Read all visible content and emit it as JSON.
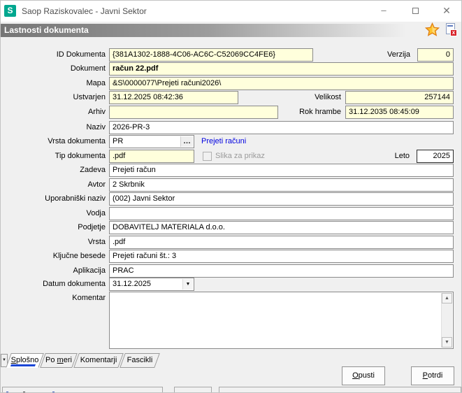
{
  "window": {
    "title": "Saop Raziskovalec - Javni Sektor",
    "logo_letter": "S"
  },
  "header": {
    "title": "Lastnosti dokumenta"
  },
  "icons": {
    "minimize": "–",
    "close": "✕",
    "star": "★",
    "doc_delete_x": "x",
    "ellipsis": "…",
    "dropdown": "▼",
    "tab_scroll": "▼",
    "scroll_up": "▲",
    "scroll_down": "▼"
  },
  "colors": {
    "logo-teal": "#00a78f",
    "field-yellow": "#ffffdc",
    "border-field": "#8a8a8a",
    "link-blue": "#0000e0",
    "tab-accent": "#1b46d6"
  },
  "fields": {
    "id": {
      "label": "ID Dokumenta",
      "value": "{381A1302-1888-4C06-AC6C-C52069CC4FE6}"
    },
    "verzija": {
      "label": "Verzija",
      "value": "0"
    },
    "dokument": {
      "label": "Dokument",
      "value": "račun 22.pdf"
    },
    "mapa": {
      "label": "Mapa",
      "value": "&S\\0000077\\Prejeti računi2026\\"
    },
    "ustvarjen": {
      "label": "Ustvarjen",
      "value": "31.12.2025 08:42:36"
    },
    "velikost": {
      "label": "Velikost",
      "value": "257144"
    },
    "arhiv": {
      "label": "Arhiv",
      "value": ""
    },
    "rok_hrambe": {
      "label": "Rok hrambe",
      "value": "31.12.2035 08:45:09"
    },
    "naziv": {
      "label": "Naziv",
      "value": "2026-PR-3"
    },
    "vrsta_dokumenta": {
      "label": "Vrsta dokumenta",
      "value": "PR",
      "link": "Prejeti računi"
    },
    "tip_dokumenta": {
      "label": "Tip dokumenta",
      "value": ".pdf",
      "checkbox_label": "Slika za prikaz"
    },
    "leto": {
      "label": "Leto",
      "value": "2025"
    },
    "zadeva": {
      "label": "Zadeva",
      "value": "Prejeti račun"
    },
    "avtor": {
      "label": "Avtor",
      "value": "2 Skrbnik"
    },
    "uporabniski_naziv": {
      "label": "Uporabniški naziv",
      "value": "(002) Javni Sektor"
    },
    "vodja": {
      "label": "Vodja",
      "value": ""
    },
    "podjetje": {
      "label": "Podjetje",
      "value": "DOBAVITELJ MATERIALA d.o.o."
    },
    "vrsta": {
      "label": "Vrsta",
      "value": ".pdf"
    },
    "kljucne_besede": {
      "label": "Ključne besede",
      "value": "Prejeti računi št.: 3"
    },
    "aplikacija": {
      "label": "Aplikacija",
      "value": "PRAC"
    },
    "datum_dokumenta": {
      "label": "Datum dokumenta",
      "value": "31.12.2025"
    },
    "komentar": {
      "label": "Komentar",
      "value": ""
    }
  },
  "tabs": [
    {
      "pre": "",
      "accel": "S",
      "post": "plošno",
      "active": true
    },
    {
      "pre": "Po ",
      "accel": "m",
      "post": "eri",
      "active": false
    },
    {
      "pre": "Komentarji",
      "accel": "",
      "post": "",
      "active": false
    },
    {
      "pre": "Fascikli",
      "accel": "",
      "post": "",
      "active": false
    }
  ],
  "buttons": {
    "opusti": {
      "accel": "O",
      "rest": "pusti"
    },
    "potrdi": {
      "accel": "P",
      "rest": "otrdi"
    }
  }
}
